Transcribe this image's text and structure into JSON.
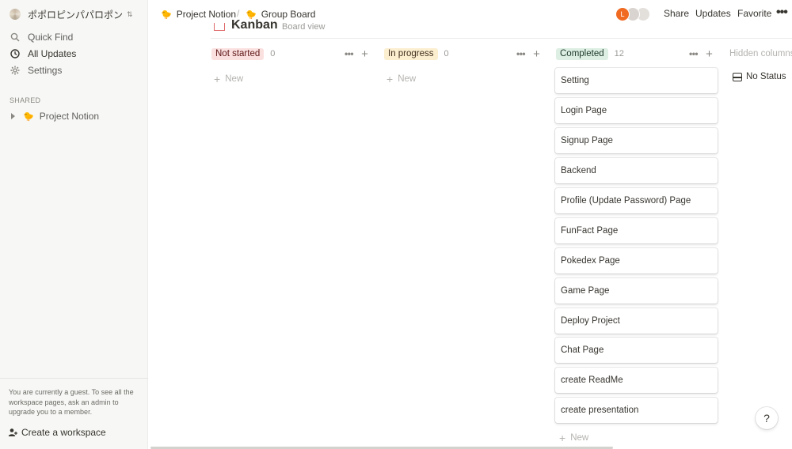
{
  "sidebar": {
    "workspace_name": "ポポロピンパパロポン",
    "workspace_chevron": "⇅",
    "nav": [
      {
        "label": "Quick Find",
        "icon": "search-icon"
      },
      {
        "label": "All Updates",
        "icon": "clock-icon"
      },
      {
        "label": "Settings",
        "icon": "gear-icon"
      }
    ],
    "shared_label": "SHARED",
    "shared_items": [
      {
        "label": "Project Notion",
        "emoji": "🐤"
      }
    ],
    "guest_note": "You are currently a guest. To see all the workspace pages, ask an admin to upgrade you to a member.",
    "create_workspace": "Create a workspace"
  },
  "topbar": {
    "breadcrumb": [
      {
        "label": "Project Notion",
        "emoji": "🐤"
      },
      {
        "label": "Group Board",
        "emoji": "🐤"
      }
    ],
    "breadcrumb_sep": "/",
    "avatar_initial": "L",
    "share": "Share",
    "updates": "Updates",
    "favorite": "Favorite",
    "more": "•••"
  },
  "page": {
    "title": "Kanban",
    "view_label": "Board view"
  },
  "board": {
    "new_label": "New",
    "more_glyph": "•••",
    "plus_glyph": "+",
    "columns": [
      {
        "status": "Not started",
        "count": "0"
      },
      {
        "status": "In progress",
        "count": "0"
      },
      {
        "status": "Completed",
        "count": "12"
      }
    ],
    "completed_cards": [
      "Setting",
      "Login Page",
      "Signup Page",
      "Backend",
      "Profile (Update Password) Page",
      "FunFact Page",
      "Pokedex Page",
      "Game Page",
      "Deploy Project",
      "Chat Page",
      "create ReadMe",
      "create presentation"
    ],
    "hidden_columns_label": "Hidden columns",
    "no_status_label": "No Status"
  },
  "help": "?",
  "colors": {
    "not_started_bg": "#fbe0e0",
    "in_progress_bg": "#fbefd0",
    "completed_bg": "#dcefe2",
    "avatar_orange": "#f06a22",
    "sidebar_bg": "#f7f7f5"
  }
}
